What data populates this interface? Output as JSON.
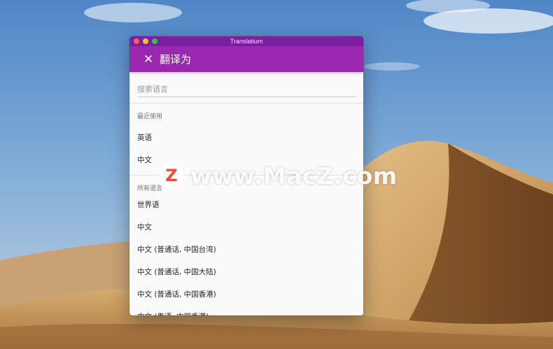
{
  "watermark": {
    "badge": "Z",
    "text": "www.MacZ.com"
  },
  "window": {
    "title": "Translatium",
    "appbar": {
      "title": "翻译为",
      "close_icon": "close-icon"
    },
    "search": {
      "placeholder": "搜索语言",
      "value": ""
    },
    "recent": {
      "header": "最近使用",
      "items": [
        "英语",
        "中文"
      ]
    },
    "all": {
      "header": "所有语言",
      "items": [
        "世界语",
        "中文",
        "中文 (普通话, 中国台湾)",
        "中文 (普通话, 中国大陆)",
        "中文 (普通话, 中国香港)",
        "中文 (粤语, 中国香港)"
      ]
    }
  },
  "colors": {
    "titlebar": "#7b1fa2",
    "appbar": "#9c27b0",
    "sky": "#6f9fd0",
    "dune": "#c99a62"
  }
}
